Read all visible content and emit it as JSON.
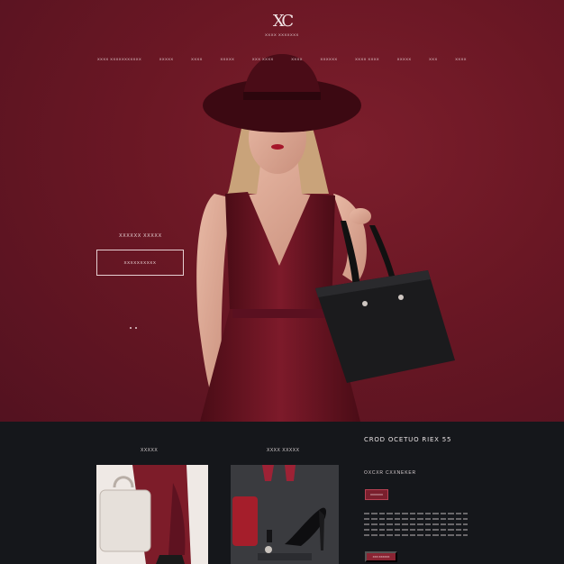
{
  "brand": {
    "logo_mark": "XC",
    "name": "XXXX XXXXXXX"
  },
  "nav": {
    "items": [
      "XXXX XXXXXXXXXXX",
      "XXXXX",
      "XXXX",
      "XXXXX",
      "XXX XXXX",
      "XXXX",
      "XXXXXX",
      "XXXX XXXX",
      "XXXXX",
      "XXX",
      "XXXX"
    ]
  },
  "hero": {
    "caption": "XXXXXX XXXXX",
    "cta_label": "XXXXXXXXXX",
    "carousel_dots": 2
  },
  "lower": {
    "col1_title": "XXXXX",
    "col2_title": "XXXX XXXXX",
    "promo_title": "CROD OCETUO RIEX 55",
    "promo_subtitle": "OXCXR  CXXNEKER",
    "promo_button": "XXXXXXX",
    "promo_button2": "XXX XXXXXX"
  },
  "colors": {
    "hero_bg": "#6a1724",
    "accent": "#7a1f2d",
    "dark_bg": "#15171b"
  }
}
